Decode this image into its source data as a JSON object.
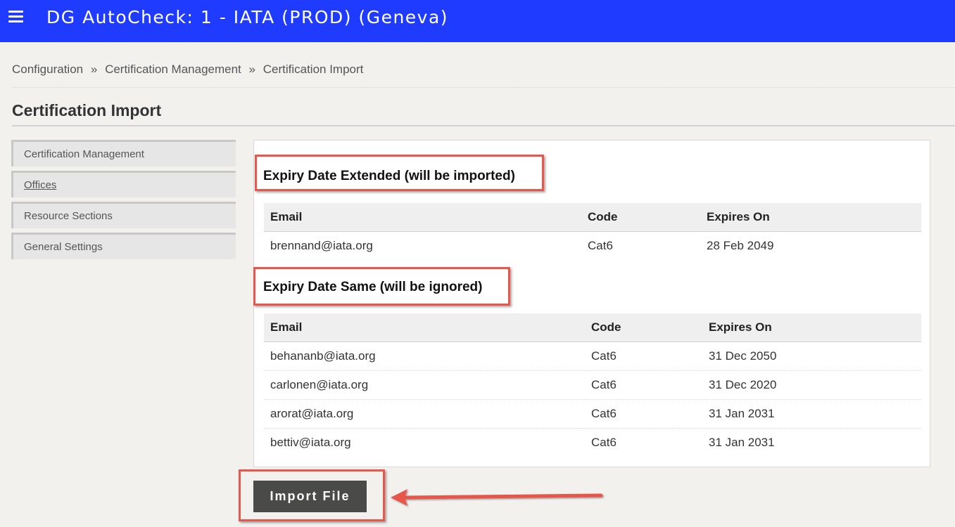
{
  "header": {
    "title": "DG AutoCheck: 1 - IATA (PROD) (Geneva)",
    "menu_icon": "hamburger-menu-icon",
    "background": "#1f3bff"
  },
  "breadcrumb": {
    "items": [
      "Configuration",
      "Certification Management",
      "Certification Import"
    ],
    "separator": "»"
  },
  "page": {
    "title": "Certification Import"
  },
  "sidebar": {
    "items": [
      {
        "label": "Certification Management"
      },
      {
        "label": "Offices"
      },
      {
        "label": "Resource Sections"
      },
      {
        "label": "General Settings"
      }
    ]
  },
  "extended": {
    "heading": "Expiry Date Extended (will be imported)",
    "columns": [
      "Email",
      "Code",
      "Expires On"
    ],
    "rows": [
      [
        "brennand@iata.org",
        "Cat6",
        "28 Feb 2049"
      ]
    ]
  },
  "same": {
    "heading": "Expiry Date Same (will be ignored)",
    "columns": [
      "Email",
      "Code",
      "Expires On"
    ],
    "rows": [
      [
        "behananb@iata.org",
        "Cat6",
        "31 Dec 2050"
      ],
      [
        "carlonen@iata.org",
        "Cat6",
        "31 Dec 2020"
      ],
      [
        "arorat@iata.org",
        "Cat6",
        "31 Jan 2031"
      ],
      [
        "bettiv@iata.org",
        "Cat6",
        "31 Jan 2031"
      ]
    ]
  },
  "actions": {
    "import_label": "Import File"
  },
  "annotation": {
    "color": "#e8574a"
  }
}
